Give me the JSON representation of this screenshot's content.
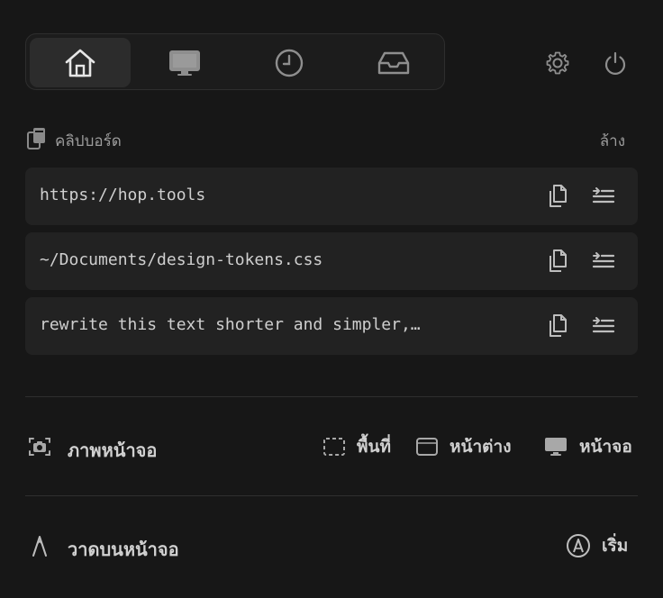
{
  "tabs": [
    {
      "name": "home",
      "icon": "home-icon"
    },
    {
      "name": "display",
      "icon": "monitor-icon"
    },
    {
      "name": "history",
      "icon": "clock-icon"
    },
    {
      "name": "inbox",
      "icon": "inbox-tray-icon"
    }
  ],
  "top_actions": {
    "settings_icon": "gear-icon",
    "power_icon": "power-icon"
  },
  "clipboard": {
    "title": "คลิปบอร์ด",
    "clear_label": "ล้าง",
    "items": [
      {
        "text": "https://hop.tools"
      },
      {
        "text": "~/Documents/design-tokens.css"
      },
      {
        "text": "rewrite this text shorter and simpler,…"
      }
    ]
  },
  "screenshot": {
    "label": "ภาพหน้าจอ",
    "options": {
      "area": "พื้นที่",
      "window": "หน้าต่าง",
      "screen": "หน้าจอ"
    }
  },
  "draw": {
    "label": "วาดบนหน้าจอ",
    "start_label": "เริ่ม"
  },
  "colors": {
    "background": "#171717",
    "row_background": "#222222",
    "active_tab": "#2c2c2c"
  }
}
